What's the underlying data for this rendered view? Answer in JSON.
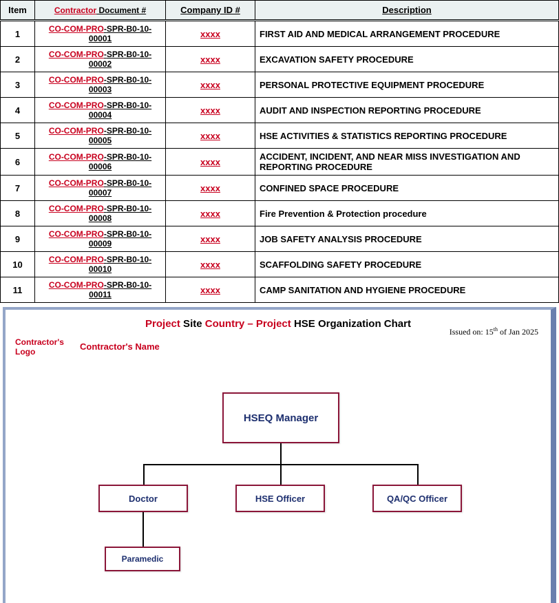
{
  "table": {
    "headers": {
      "item": "Item",
      "doc_red": "Contractor",
      "doc_black": " Document #",
      "company": "Company ID #",
      "desc": "Description"
    },
    "doc_prefix": "CO-COM-PRO",
    "company_placeholder": "xxxx",
    "rows": [
      {
        "item": "1",
        "suffix": "SPR-B0-10-00001",
        "desc": "FIRST AID AND MEDICAL ARRANGEMENT PROCEDURE"
      },
      {
        "item": "2",
        "suffix": "SPR-B0-10-00002",
        "desc": "EXCAVATION SAFETY PROCEDURE"
      },
      {
        "item": "3",
        "suffix": "SPR-B0-10-00003",
        "desc": "PERSONAL PROTECTIVE EQUIPMENT PROCEDURE"
      },
      {
        "item": "4",
        "suffix": "SPR-B0-10-00004",
        "desc": "AUDIT AND INSPECTION REPORTING PROCEDURE"
      },
      {
        "item": "5",
        "suffix": "SPR-B0-10-00005",
        "desc": "HSE ACTIVITIES & STATISTICS REPORTING PROCEDURE"
      },
      {
        "item": "6",
        "suffix": "SPR-B0-10-00006",
        "desc": "ACCIDENT, INCIDENT, AND NEAR MISS INVESTIGATION AND REPORTING PROCEDURE"
      },
      {
        "item": "7",
        "suffix": "SPR-B0-10-00007",
        "desc": "CONFINED SPACE PROCEDURE"
      },
      {
        "item": "8",
        "suffix": "SPR-B0-10-00008",
        "desc": "Fire Prevention & Protection procedure"
      },
      {
        "item": "9",
        "suffix": "SPR-B0-10-00009",
        "desc": "JOB SAFETY ANALYSIS PROCEDURE"
      },
      {
        "item": "10",
        "suffix": "SPR-B0-10-00010",
        "desc": "SCAFFOLDING SAFETY PROCEDURE"
      },
      {
        "item": "11",
        "suffix": "SPR-B0-10-00011",
        "desc": "CAMP SANITATION AND HYGIENE PROCEDURE"
      }
    ]
  },
  "org": {
    "title_parts": {
      "a": "Project",
      "b": " Site ",
      "c": "Country – Project",
      "d": "  HSE Organization Chart"
    },
    "issued_label": "Issued on: 15",
    "issued_suffix": " of Jan 2025",
    "issued_ord": "th",
    "logo_text": "Contractor's\nLogo",
    "contractor_name": "Contractor's Name",
    "nodes": {
      "manager": "HSEQ Manager",
      "doctor": "Doctor",
      "hse_officer": "HSE Officer",
      "qaqc": "QA/QC Officer",
      "paramedic": "Paramedic"
    }
  },
  "chart_data": {
    "type": "tree",
    "title": "Project Site Country – Project HSE Organization Chart",
    "root": {
      "name": "HSEQ Manager",
      "children": [
        {
          "name": "Doctor",
          "children": [
            {
              "name": "Paramedic"
            }
          ]
        },
        {
          "name": "HSE Officer"
        },
        {
          "name": "QA/QC Officer"
        }
      ]
    }
  }
}
